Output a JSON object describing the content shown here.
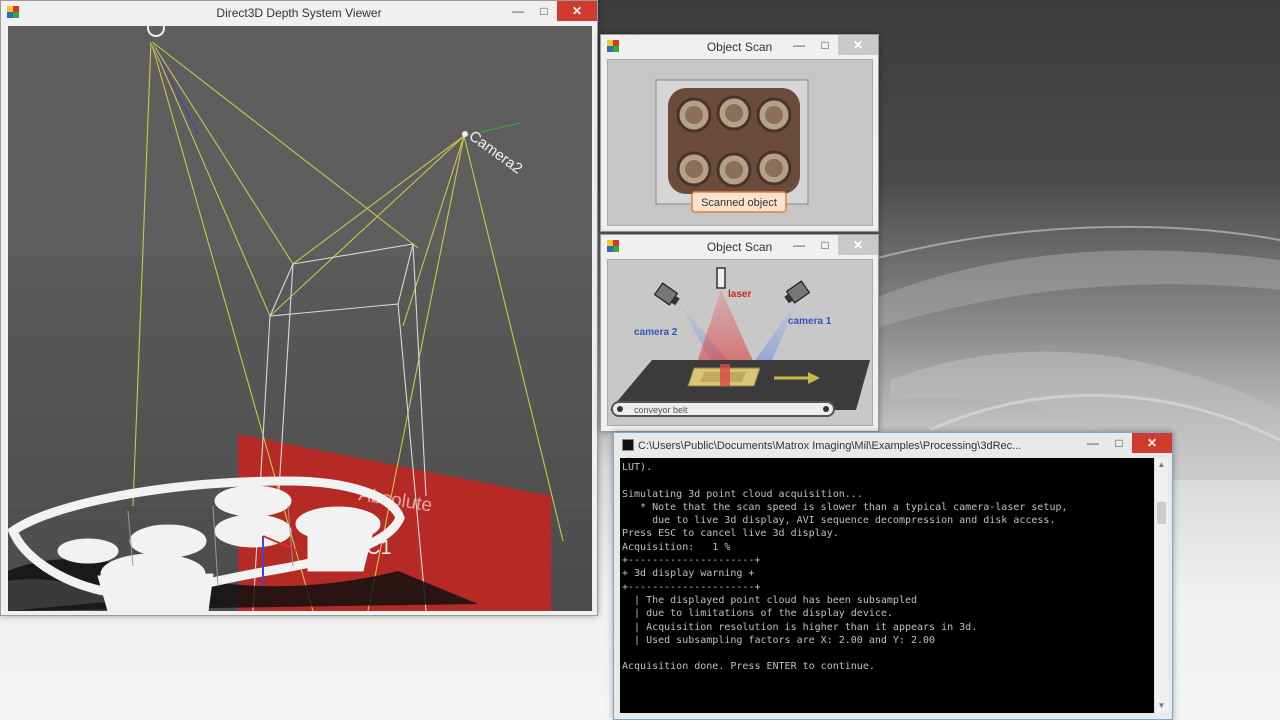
{
  "viewer": {
    "title": "Direct3D Depth System Viewer",
    "label_camera2": "Camera2",
    "label_absolute": "Absolute",
    "label_c1": "C1"
  },
  "scan_top": {
    "title": "Object Scan",
    "tooltip": "Scanned object"
  },
  "scan_bottom": {
    "title": "Object Scan",
    "laser": "laser",
    "camera2": "camera 2",
    "camera1": "camera 1",
    "belt": "conveyor belt"
  },
  "console": {
    "title": "C:\\Users\\Public\\Documents\\Matrox Imaging\\Mil\\Examples\\Processing\\3dRec...",
    "lines": [
      "LUT).",
      "",
      "Simulating 3d point cloud acquisition...",
      "   * Note that the scan speed is slower than a typical camera-laser setup,",
      "     due to live 3d display, AVI sequence decompression and disk access.",
      "Press ESC to cancel live 3d display.",
      "Acquisition:   1 %",
      "+---------------------+",
      "+ 3d display warning +",
      "+---------------------+",
      "  | The displayed point cloud has been subsampled",
      "  | due to limitations of the display device.",
      "  | Acquisition resolution is higher than it appears in 3d.",
      "  | Used subsampling factors are X: 2.00 and Y: 2.00",
      "",
      "Acquisition done. Press ENTER to continue."
    ]
  },
  "colors": {
    "frustum": "#c8c84a",
    "plane": "#b52a24",
    "console_bg": "#000000",
    "console_fg": "#c0c0c0",
    "laser": "#cc2222",
    "camera_label": "#3355bb"
  },
  "icons": [
    "app-icon",
    "minimize-icon",
    "maximize-icon",
    "close-icon",
    "console-icon"
  ]
}
